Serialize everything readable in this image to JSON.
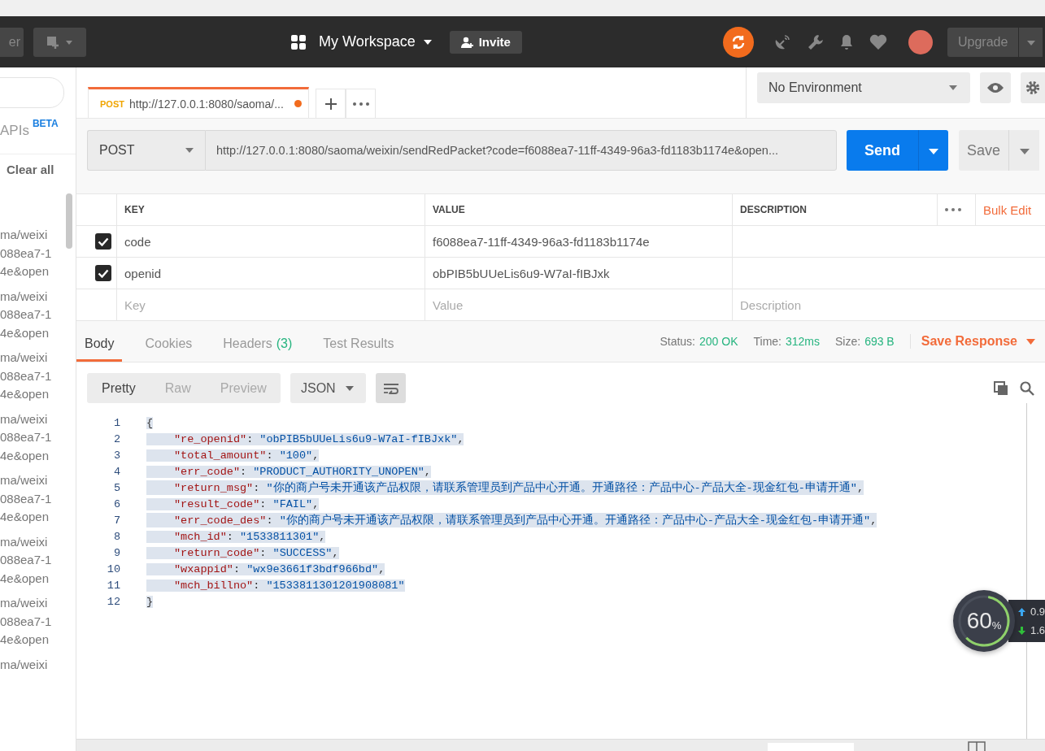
{
  "header": {
    "partial_button": "er",
    "workspace": "My Workspace",
    "invite": "Invite",
    "upgrade": "Upgrade"
  },
  "sidebar": {
    "api_label": "APIs",
    "beta": "BETA",
    "clear_all": "Clear all",
    "history": [
      {
        "lines": [
          "ma/weixi",
          "088ea7-1",
          "4e&open"
        ]
      },
      {
        "lines": [
          "ma/weixi",
          "088ea7-1",
          "4e&open"
        ]
      },
      {
        "lines": [
          "ma/weixi",
          "088ea7-1",
          "4e&open"
        ]
      },
      {
        "lines": [
          "ma/weixi",
          "088ea7-1",
          "4e&open"
        ]
      },
      {
        "lines": [
          "ma/weixi",
          "088ea7-1",
          "4e&open"
        ]
      },
      {
        "lines": [
          "ma/weixi",
          "088ea7-1",
          "4e&open"
        ]
      },
      {
        "lines": [
          "ma/weixi",
          "088ea7-1",
          "4e&open"
        ]
      },
      {
        "lines": [
          "ma/weixi"
        ]
      }
    ]
  },
  "tabs": [
    {
      "method": "POST",
      "title": "http://127.0.0.1:8080/saoma/...",
      "unsaved": true,
      "selected": true
    }
  ],
  "environment": "No Environment",
  "request": {
    "method": "POST",
    "url": "http://127.0.0.1:8080/saoma/weixin/sendRedPacket?code=f6088ea7-11ff-4349-96a3-fd1183b1174e&open...",
    "send": "Send",
    "save": "Save"
  },
  "params": {
    "columns": [
      "KEY",
      "VALUE",
      "DESCRIPTION"
    ],
    "bulk_edit": "Bulk Edit",
    "rows": [
      {
        "checked": true,
        "key": "code",
        "value": "f6088ea7-11ff-4349-96a3-fd1183b1174e"
      },
      {
        "checked": true,
        "key": "openid",
        "value": "obPIB5bUUeLis6u9-W7aI-fIBJxk"
      }
    ],
    "empty_row": [
      {
        "placeholder": "Key"
      },
      {
        "placeholder": "Value"
      },
      {
        "placeholder": "Description"
      }
    ]
  },
  "response_tabs": [
    {
      "label": "Body",
      "selected": true
    },
    {
      "label": "Cookies",
      "selected": false
    },
    {
      "label": "Headers",
      "count": "(3)",
      "selected": false
    },
    {
      "label": "Test Results",
      "selected": false
    }
  ],
  "status": [
    {
      "label": "Status:",
      "value": "200 OK"
    },
    {
      "label": "Time:",
      "value": "312ms"
    },
    {
      "label": "Size:",
      "value": "693 B"
    }
  ],
  "save_response": "Save Response",
  "view_modes": [
    {
      "label": "Pretty",
      "selected": true
    },
    {
      "label": "Raw",
      "selected": false
    },
    {
      "label": "Preview",
      "selected": false
    }
  ],
  "format": "JSON",
  "code_lines": [
    {
      "number": "1",
      "selected": true,
      "tokens": [
        {
          "kind": "punct",
          "text": "{"
        }
      ]
    },
    {
      "number": "2",
      "selected": true,
      "tokens": [
        {
          "kind": "key",
          "text": "\"re_openid\""
        },
        {
          "kind": "punct",
          "text": ": "
        },
        {
          "kind": "string",
          "text": "\"obPIB5bUUeLis6u9-W7aI-fIBJxk\""
        },
        {
          "kind": "punct",
          "text": ","
        }
      ]
    },
    {
      "number": "3",
      "selected": true,
      "tokens": [
        {
          "kind": "key",
          "text": "\"total_amount\""
        },
        {
          "kind": "punct",
          "text": ": "
        },
        {
          "kind": "string",
          "text": "\"100\""
        },
        {
          "kind": "punct",
          "text": ","
        }
      ]
    },
    {
      "number": "4",
      "selected": true,
      "tokens": [
        {
          "kind": "key",
          "text": "\"err_code\""
        },
        {
          "kind": "punct",
          "text": ": "
        },
        {
          "kind": "string",
          "text": "\"PRODUCT_AUTHORITY_UNOPEN\""
        },
        {
          "kind": "punct",
          "text": ","
        }
      ]
    },
    {
      "number": "5",
      "selected": true,
      "tokens": [
        {
          "kind": "key",
          "text": "\"return_msg\""
        },
        {
          "kind": "punct",
          "text": ": "
        },
        {
          "kind": "string",
          "text": "\"你的商户号未开通该产品权限，请联系管理员到产品中心开通。开通路径：产品中心-产品大全-现金红包-申请开通\""
        },
        {
          "kind": "punct",
          "text": ","
        }
      ]
    },
    {
      "number": "6",
      "selected": true,
      "tokens": [
        {
          "kind": "key",
          "text": "\"result_code\""
        },
        {
          "kind": "punct",
          "text": ": "
        },
        {
          "kind": "string",
          "text": "\"FAIL\""
        },
        {
          "kind": "punct",
          "text": ","
        }
      ]
    },
    {
      "number": "7",
      "selected": true,
      "tokens": [
        {
          "kind": "key",
          "text": "\"err_code_des\""
        },
        {
          "kind": "punct",
          "text": ": "
        },
        {
          "kind": "string",
          "text": "\"你的商户号未开通该产品权限，请联系管理员到产品中心开通。开通路径：产品中心-产品大全-现金红包-申请开通\""
        },
        {
          "kind": "punct",
          "text": ","
        }
      ]
    },
    {
      "number": "8",
      "selected": true,
      "tokens": [
        {
          "kind": "key",
          "text": "\"mch_id\""
        },
        {
          "kind": "punct",
          "text": ": "
        },
        {
          "kind": "string",
          "text": "\"1533811301\""
        },
        {
          "kind": "punct",
          "text": ","
        }
      ]
    },
    {
      "number": "9",
      "selected": true,
      "tokens": [
        {
          "kind": "key",
          "text": "\"return_code\""
        },
        {
          "kind": "punct",
          "text": ": "
        },
        {
          "kind": "string",
          "text": "\"SUCCESS\""
        },
        {
          "kind": "punct",
          "text": ","
        }
      ]
    },
    {
      "number": "10",
      "selected": true,
      "tokens": [
        {
          "kind": "key",
          "text": "\"wxappid\""
        },
        {
          "kind": "punct",
          "text": ": "
        },
        {
          "kind": "string",
          "text": "\"wx9e3661f3bdf966bd\""
        },
        {
          "kind": "punct",
          "text": ","
        }
      ]
    },
    {
      "number": "11",
      "selected": true,
      "tokens": [
        {
          "kind": "key",
          "text": "\"mch_billno\""
        },
        {
          "kind": "punct",
          "text": ": "
        },
        {
          "kind": "string",
          "text": "\"1533811301201908081\""
        }
      ]
    },
    {
      "number": "12",
      "selected": true,
      "tokens": [
        {
          "kind": "punct",
          "text": "}"
        }
      ]
    }
  ],
  "meter": {
    "level": 0.6,
    "value": "60",
    "unit": "%",
    "up": "0.9",
    "down": "1.6"
  }
}
